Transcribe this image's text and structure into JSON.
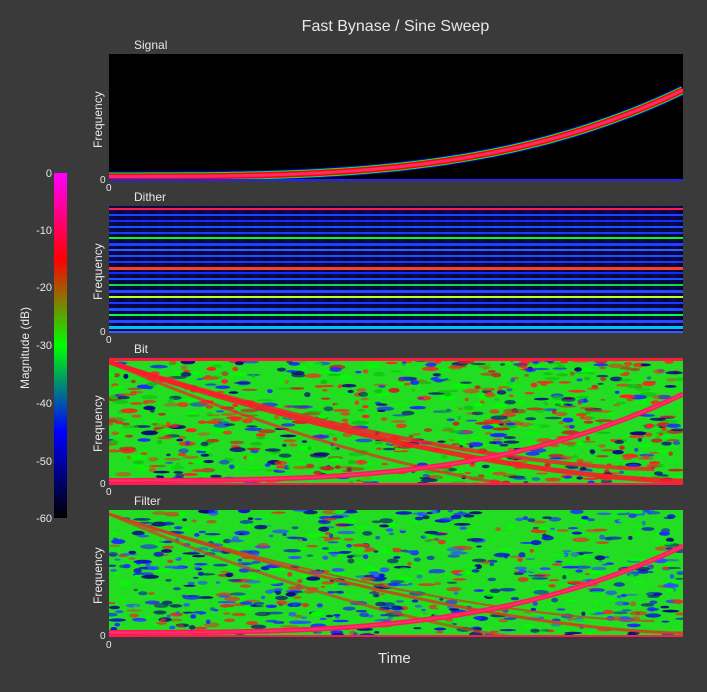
{
  "chart_data": {
    "type": "heatmap",
    "title": "Fast Bynase / Sine Sweep",
    "xlabel": "Time",
    "x_tick": "0",
    "colorbar": {
      "label": "Magnitude (dB)",
      "ticks": [
        "0",
        "-10",
        "-20",
        "-30",
        "-40",
        "-50",
        "-60"
      ],
      "range": [
        -60,
        0
      ],
      "colors": [
        "#000000",
        "#0000ff",
        "#00ff00",
        "#ff0000",
        "#ff00ff"
      ]
    },
    "panels": [
      {
        "name": "Signal",
        "ylabel": "Frequency",
        "y_tick": "0",
        "pattern": "sweep"
      },
      {
        "name": "Dither",
        "ylabel": "Frequency",
        "y_tick": "0",
        "pattern": "bands"
      },
      {
        "name": "Bit",
        "ylabel": "Frequency",
        "y_tick": "0",
        "pattern": "noise-red"
      },
      {
        "name": "Filter",
        "ylabel": "Frequency",
        "y_tick": "0",
        "pattern": "noise-green"
      }
    ]
  }
}
